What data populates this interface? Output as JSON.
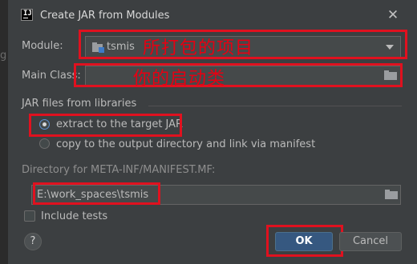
{
  "window": {
    "title": "Create JAR from Modules"
  },
  "background": {
    "edge_letter": "g"
  },
  "module": {
    "label": "Module:",
    "value": "tsmis",
    "annotation": "所打包的项目"
  },
  "main_class": {
    "label": "Main Class:",
    "value": "",
    "annotation": "你的启动类"
  },
  "libraries": {
    "section_title": "JAR files from libraries",
    "options": [
      {
        "label": "extract to the target JAR",
        "selected": true
      },
      {
        "label": "copy to the output directory and link via manifest",
        "selected": false
      }
    ]
  },
  "manifest": {
    "label": "Directory for META-INF/MANIFEST.MF:",
    "value": "E:\\work_spaces\\tsmis"
  },
  "include_tests": {
    "label": "Include tests",
    "checked": false
  },
  "buttons": {
    "help": "?",
    "ok": "OK",
    "cancel": "Cancel"
  },
  "colors": {
    "annotation_red": "#e0111f",
    "ok_blue": "#365880",
    "dialog_bg": "#3c3f41"
  }
}
